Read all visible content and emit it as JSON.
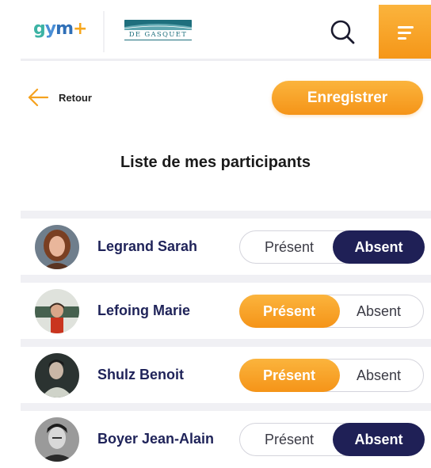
{
  "header": {
    "logo_gym": {
      "g": "g",
      "y": "y",
      "m": "m",
      "plus": "+"
    },
    "logo_partner": "DE GASQUET",
    "search_icon": "search-icon",
    "menu_icon": "menu-icon"
  },
  "toolbar": {
    "back_label": "Retour",
    "save_label": "Enregistrer"
  },
  "title": "Liste de mes participants",
  "options": {
    "present": "Présent",
    "absent": "Absent"
  },
  "participants": [
    {
      "name": "Legrand Sarah",
      "status": "absent"
    },
    {
      "name": "Lefoing Marie",
      "status": "present"
    },
    {
      "name": "Shulz Benoit",
      "status": "present"
    },
    {
      "name": "Boyer Jean-Alain",
      "status": "absent"
    }
  ],
  "colors": {
    "accent": "#f7a21f",
    "navy": "#1f2056",
    "separator": "#f0f0f4"
  }
}
